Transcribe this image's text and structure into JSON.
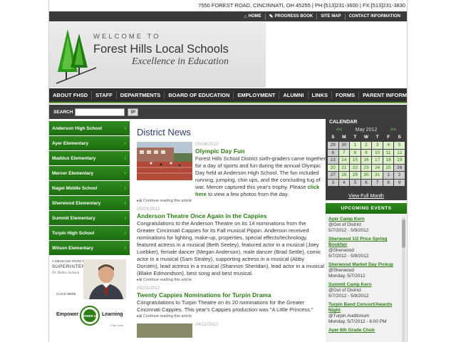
{
  "header": {
    "contact": "7550 FOREST ROAD, CINCINNATI, OH 45255 | PH:[513]231-3600 | FX:[513]231-3830",
    "util_links": [
      {
        "label": "HOME",
        "icon": "home-icon"
      },
      {
        "label": "PROGRESS BOOK",
        "icon": "book-icon"
      },
      {
        "label": "SITE MAP",
        "icon": ""
      },
      {
        "label": "CONTACT INFORMATION",
        "icon": ""
      }
    ]
  },
  "banner": {
    "welcome": "WELCOME TO",
    "school_name": "Forest Hills Local Schools",
    "tagline": "Excellence in Education"
  },
  "nav": {
    "items": [
      "ABOUT FHSD",
      "STAFF",
      "DEPARTMENTS",
      "BOARD OF EDUCATION",
      "EMPLOYMENT",
      "ALUMNI",
      "LINKS",
      "FORMS",
      "PARENT INFORMATION"
    ]
  },
  "search": {
    "label": "SEARCH",
    "button": "go"
  },
  "schools": [
    "Anderson High School",
    "Ayer Elementary",
    "Maddux Elementary",
    "Mercer Elementary",
    "Nagel Middle School",
    "Sherwood Elementary",
    "Summit Elementary",
    "Turpin High School",
    "Wilson Elementary"
  ],
  "superintendent": {
    "message": "A MESSAGE FROM THE",
    "title": "SUPERINTENDENT",
    "name": "Dr. Dallas Jackson",
    "click": "CLICK HERE"
  },
  "empower": {
    "left": "Empower",
    "badge": "POWER UP",
    "right": "Learning",
    "click": "Click Here"
  },
  "news": {
    "heading": "District News",
    "readmore": "Continue reading this article",
    "articles": [
      {
        "date": "05/04/2012",
        "title": "Olympic Day Fun",
        "body": "Forest Hills School District sixth-graders came together for a day of sports and fun during the annual Olympic Day held at Anderson High School. The fun included running, jumping, chin ups, and the concluding tug of war. Mercer captured this year's trophy. Please",
        "link": "click here",
        "body_end": "to view a few photos from the day."
      },
      {
        "date": "05/03/2012",
        "title": "Anderson Theatre Once Again in the Cappies",
        "body": "Congratulations to the Anderson Theatre on its 14 nominations from the Greater Cincinnati Cappies for its Fall musical Pippin. Anderson received nominations for lighting, make-up, properties, special effects/technology, featured actress in a musical (Beth Seeley), featured actor in a musical (Joey Loebker), female dancer (Megan Anderson), male dancer (Brad Settle), comic actor in a musical (Sam Straley), supporting actress in a musical (Abby Dorsten), lead actress in a musical (Shannon Sheridan), lead actor in a musical (Blake Edmondson), best song and best musical."
      },
      {
        "date": "05/03/2012",
        "title": "Twenty Cappies Nominations for Turpin Drama",
        "body": "Congratulations to Turpin Theatre on its 20 nominations for the Greater Cincinnati Cappies. This year's Cappies production was \"A Little Princess.\""
      },
      {
        "date": "04/11/2012"
      }
    ]
  },
  "calendar": {
    "heading": "CALENDAR",
    "prev": "<<",
    "next": ">>",
    "month": "May 2012",
    "dow": [
      "S",
      "M",
      "T",
      "W",
      "T",
      "F",
      "S"
    ],
    "weeks": [
      [
        "29",
        "30",
        "1",
        "2",
        "3",
        "4",
        "5"
      ],
      [
        "6",
        "7",
        "8",
        "9",
        "10",
        "11",
        "12"
      ],
      [
        "13",
        "14",
        "15",
        "16",
        "17",
        "18",
        "19"
      ],
      [
        "20",
        "21",
        "22",
        "23",
        "24",
        "25",
        "26"
      ],
      [
        "27",
        "28",
        "29",
        "30",
        "31",
        "1",
        "2"
      ],
      [
        "3",
        "4",
        "5",
        "6",
        "7",
        "8",
        "9"
      ]
    ],
    "full_view": "View Full Month"
  },
  "events": {
    "heading": "UPCOMING EVENTS",
    "items": [
      {
        "title": "Ayer Camp Kern",
        "location": "@Out of District",
        "date": "5/7/2012 - 5/9/2012"
      },
      {
        "title": "Sherwood 1/2 Price Spring Bookfair",
        "location": "@Sherwood",
        "date": "5/7/2012 - 5/9/2012"
      },
      {
        "title": "Sherwood Market Day Pickup",
        "location": "@Sherwood",
        "date": "Monday, 5/7/2012"
      },
      {
        "title": "Summit Camp Kern",
        "location": "@Out of District",
        "date": "5/7/2012 - 5/9/2012"
      },
      {
        "title": "Turpin Band Concert/Awards Night",
        "location": "@Turpin Auditorium",
        "date": "Monday, 5/7/2012 - 6:00 PM"
      },
      {
        "title": "Ayer 6th Grade Choir",
        "location": "",
        "date": ""
      }
    ]
  },
  "colors": {
    "accent_green": "#2b7d14",
    "nav_dark": "#2e2e2e",
    "heading_blue": "#2f3e6b"
  }
}
